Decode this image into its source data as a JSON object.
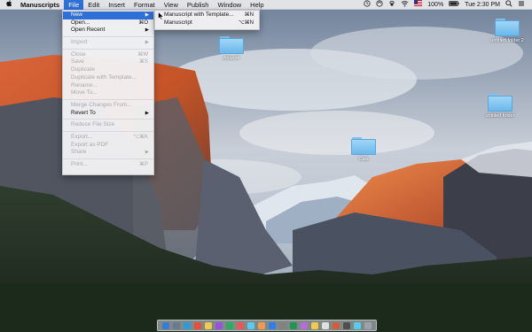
{
  "menubar": {
    "app_name": "Manuscripts",
    "menus": [
      "File",
      "Edit",
      "Insert",
      "Format",
      "View",
      "Publish",
      "Window",
      "Help"
    ],
    "active_menu": "File",
    "status": {
      "battery": "100%",
      "time": "Tue 2:30 PM",
      "icons": [
        "clock-icon",
        "sync-icon",
        "paw-icon",
        "wifi-icon",
        "flag-icon",
        "battery-icon",
        "search-icon",
        "list-icon"
      ]
    }
  },
  "file_menu": {
    "items": [
      {
        "label": "New",
        "shortcut": "",
        "submenu": true,
        "enabled": true,
        "highlighted": true
      },
      {
        "label": "Open...",
        "shortcut": "⌘O",
        "submenu": false,
        "enabled": true
      },
      {
        "label": "Open Recent",
        "shortcut": "",
        "submenu": true,
        "enabled": true
      },
      {
        "label": "Import",
        "shortcut": "",
        "submenu": true,
        "enabled": false
      },
      {
        "label": "Close",
        "shortcut": "⌘W",
        "submenu": false,
        "enabled": false
      },
      {
        "label": "Save",
        "shortcut": "⌘S",
        "submenu": false,
        "enabled": false
      },
      {
        "label": "Duplicate",
        "shortcut": "",
        "submenu": false,
        "enabled": false
      },
      {
        "label": "Duplicate with Template...",
        "shortcut": "",
        "submenu": false,
        "enabled": false
      },
      {
        "label": "Rename...",
        "shortcut": "",
        "submenu": false,
        "enabled": false
      },
      {
        "label": "Move To...",
        "shortcut": "",
        "submenu": false,
        "enabled": false
      },
      {
        "label": "Merge Changes From...",
        "shortcut": "",
        "submenu": false,
        "enabled": false
      },
      {
        "label": "Revert To",
        "shortcut": "",
        "submenu": true,
        "enabled": true
      },
      {
        "label": "Reduce File Size",
        "shortcut": "",
        "submenu": false,
        "enabled": false
      },
      {
        "label": "Export...",
        "shortcut": "⌥⌘K",
        "submenu": false,
        "enabled": false
      },
      {
        "label": "Export as PDF",
        "shortcut": "",
        "submenu": false,
        "enabled": false
      },
      {
        "label": "Share",
        "shortcut": "",
        "submenu": true,
        "enabled": false
      },
      {
        "label": "Print...",
        "shortcut": "⌘P",
        "submenu": false,
        "enabled": false
      }
    ]
  },
  "new_submenu": {
    "items": [
      {
        "label": "Manuscript with Template...",
        "shortcut": "⌘N"
      },
      {
        "label": "Manuscript",
        "shortcut": "⌥⌘N"
      }
    ]
  },
  "desktop": {
    "folders": [
      {
        "label": "Artwork"
      },
      {
        "label": "untitled folder 2"
      },
      {
        "label": "untitled folder"
      },
      {
        "label": "Cats"
      }
    ]
  },
  "colors": {
    "highlight": "#2f6fd8",
    "folder": "#6cb8ea"
  }
}
